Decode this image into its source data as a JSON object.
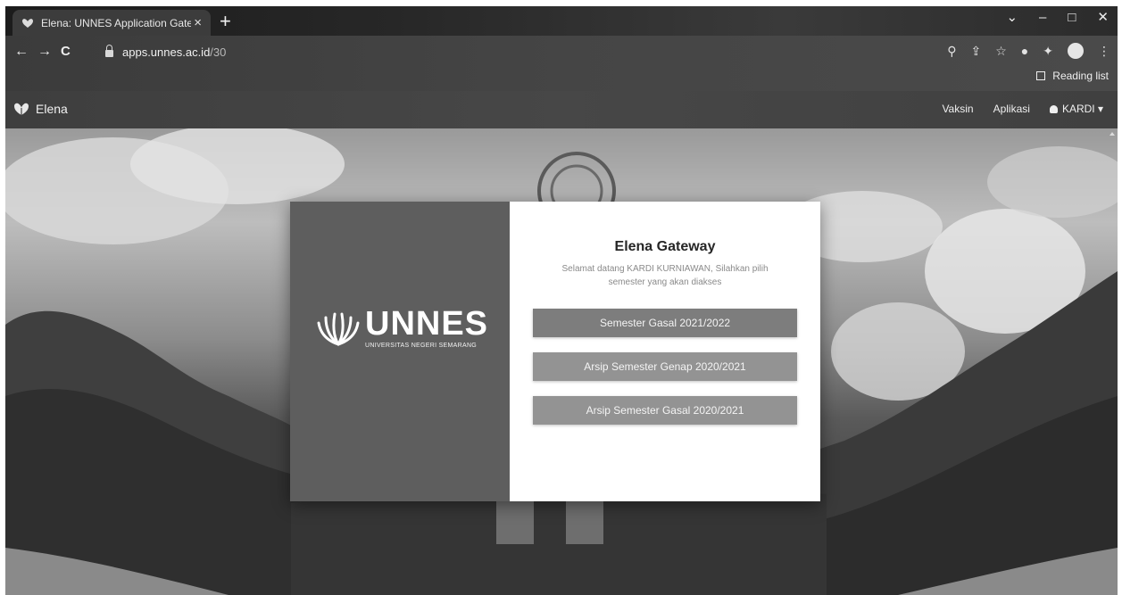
{
  "browser": {
    "tab_title": "Elena: UNNES Application Gatew",
    "tab_close": "×",
    "new_tab": "+",
    "url_host": "apps.unnes.ac.id",
    "url_path": "/30",
    "reading_list": "Reading list",
    "window_controls": {
      "chevron": "⌄",
      "minimize": "–",
      "maximize": "□",
      "close": "✕"
    },
    "nav": {
      "back": "←",
      "forward": "→",
      "reload": "C"
    },
    "toolbar_icons": {
      "search": "⚲",
      "share": "⇪",
      "star": "☆",
      "extension": "●",
      "puzzle": "✦",
      "menu": "⋮"
    }
  },
  "navbar": {
    "brand": "Elena",
    "links": [
      "Vaksin",
      "Aplikasi"
    ],
    "user": "KARDI",
    "user_caret": "▾"
  },
  "card": {
    "logo_word": "UNNES",
    "logo_subtitle": "UNIVERSITAS NEGERI SEMARANG",
    "title": "Elena Gateway",
    "description": "Selamat datang KARDI KURNIAWAN, Silahkan pilih semester yang akan diakses",
    "buttons": [
      "Semester Gasal 2021/2022",
      "Arsip Semester Genap 2020/2021",
      "Arsip Semester Gasal 2020/2021"
    ]
  }
}
